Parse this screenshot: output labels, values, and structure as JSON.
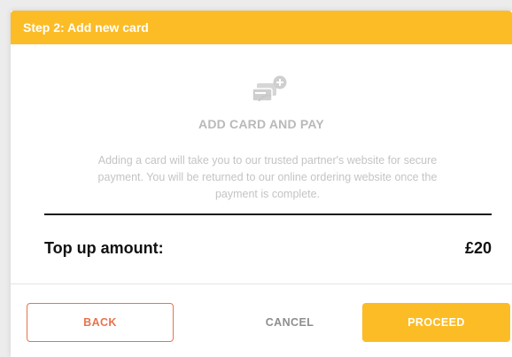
{
  "header": {
    "title": "Step 2: Add new card"
  },
  "add_card": {
    "icon": "add-card-icon",
    "title": "ADD CARD AND PAY",
    "description": "Adding a card will take you to our trusted partner's website for secure payment. You will be returned to our online ordering website once the payment is complete."
  },
  "topup": {
    "label": "Top up amount:",
    "value": "£20"
  },
  "buttons": {
    "back": "BACK",
    "cancel": "CANCEL",
    "proceed": "PROCEED"
  },
  "colors": {
    "accent": "#fcbc26",
    "back_border": "#e8734e",
    "muted_text": "#b9b9b9"
  }
}
